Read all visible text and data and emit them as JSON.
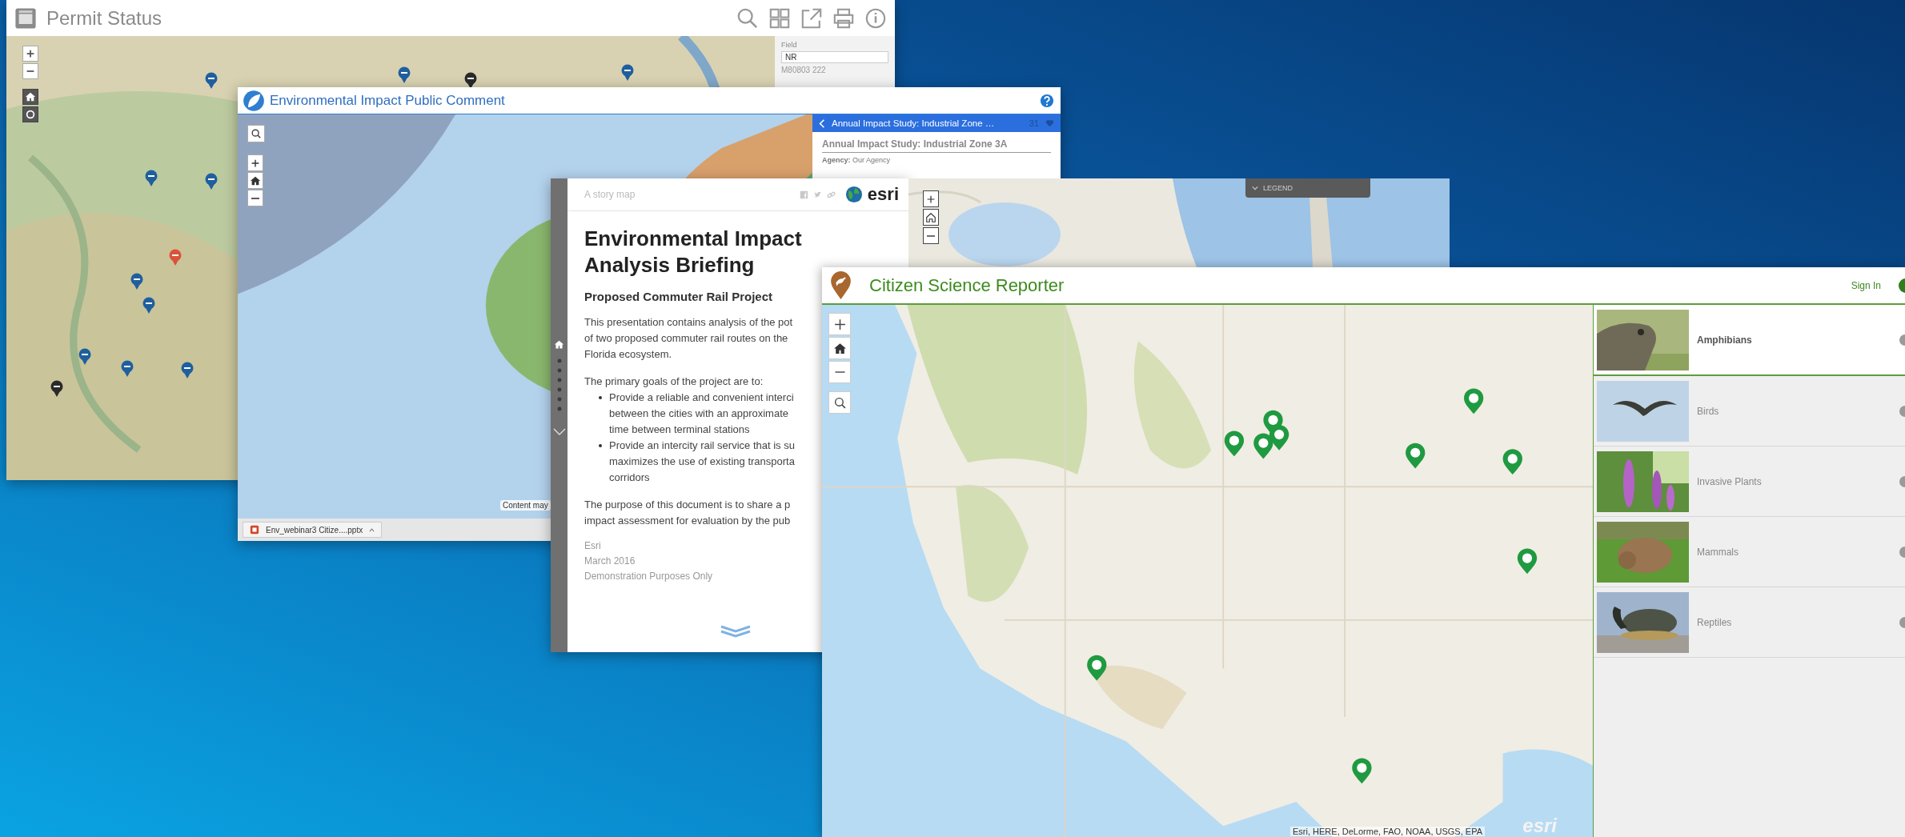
{
  "permit_status": {
    "title": "Permit Status",
    "panel": {
      "label": "Field",
      "value": "NR",
      "row": "M80803 222"
    }
  },
  "public_comment": {
    "title": "Environmental Impact Public Comment",
    "panel": {
      "header": "Annual Impact Study: Industrial Zone …",
      "count": "31",
      "title": "Annual Impact Study: Industrial Zone 3A",
      "agency": "**Agency:** Our Agency"
    },
    "map_note": "Content may",
    "taskbar_item": "Env_webinar3 Citize....pptx"
  },
  "story_map": {
    "label": "A story map",
    "logo": "esri",
    "title": "Environmental Impact Analysis Briefing",
    "subtitle": "Proposed Commuter Rail Project",
    "blocks": [
      {
        "kind": "para",
        "lines": [
          "This presentation contains analysis of the pot",
          "of two proposed commuter rail routes on the",
          "Florida ecosystem."
        ]
      },
      {
        "kind": "para",
        "lines": [
          "The primary goals of the project are to:"
        ]
      },
      {
        "kind": "bullet",
        "lines": [
          "Provide a reliable and convenient interci",
          "between the cities with an approximate",
          "time between terminal stations"
        ]
      },
      {
        "kind": "bullet",
        "lines": [
          "Provide an intercity rail service that is su",
          "maximizes the use of existing transporta",
          "corridors"
        ]
      },
      {
        "kind": "para",
        "lines": [
          "The purpose of this document is to share a p",
          "impact assessment for evaluation by the pub"
        ]
      }
    ],
    "byline": [
      "Esri",
      "March 2016",
      "Demonstration Purposes Only"
    ]
  },
  "legend_map": {
    "legend": "LEGEND"
  },
  "citizen_reporter": {
    "title": "Citizen Science Reporter",
    "sign_in": "Sign In",
    "categories": [
      {
        "label": "Amphibians",
        "selected": true
      },
      {
        "label": "Birds",
        "selected": false
      },
      {
        "label": "Invasive Plants",
        "selected": false
      },
      {
        "label": "Mammals",
        "selected": false
      },
      {
        "label": "Reptiles",
        "selected": false
      }
    ],
    "attribution": "Esri, HERE, DeLorme, FAO, NOAA, USGS, EPA",
    "map_logo": "esri"
  }
}
